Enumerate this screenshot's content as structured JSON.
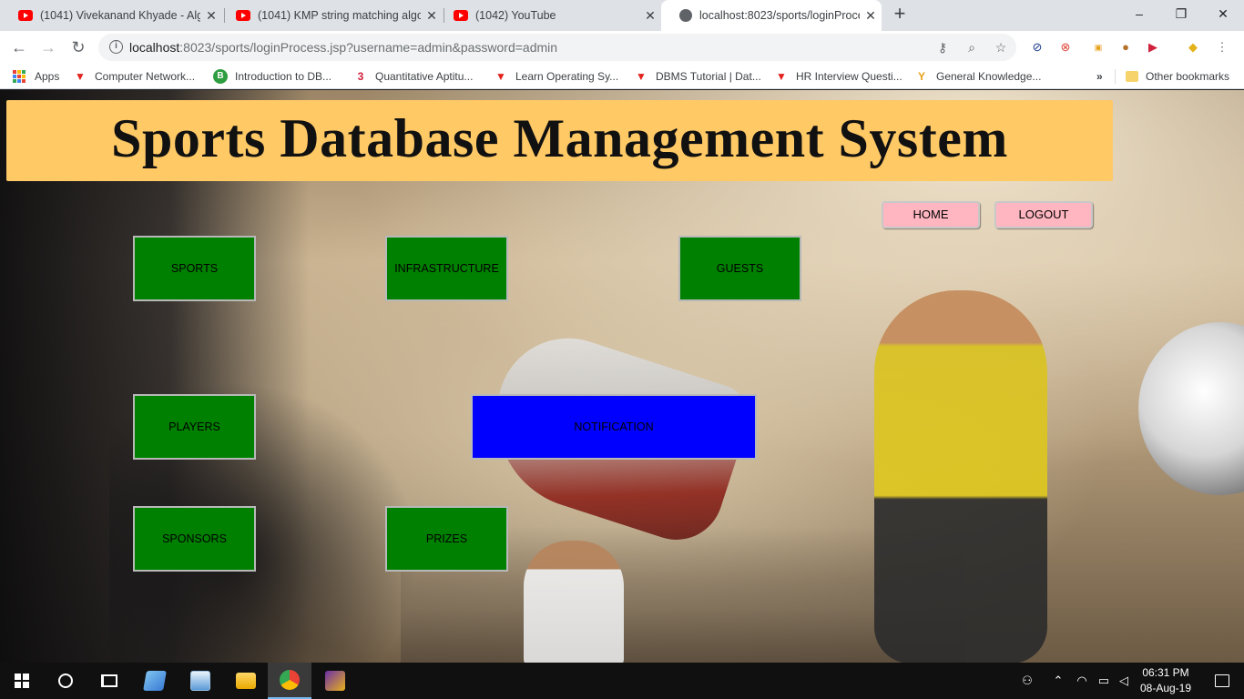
{
  "browser": {
    "tabs": [
      {
        "title": "(1041) Vivekanand Khyade - Algo",
        "favicon": "youtube-icon",
        "active": false
      },
      {
        "title": "(1041) KMP string matching algo",
        "favicon": "youtube-icon",
        "active": false
      },
      {
        "title": "(1042) YouTube",
        "favicon": "youtube-icon",
        "active": false
      },
      {
        "title": "localhost:8023/sports/loginProce",
        "favicon": "globe-icon",
        "active": true
      }
    ],
    "new_tab_label": "+",
    "window_controls": {
      "minimize": "–",
      "restore": "❐",
      "close": "✕"
    },
    "url": {
      "host": "localhost",
      "rest": ":8023/sports/loginProcess.jsp?username=admin&password=admin"
    },
    "bookmarks": [
      {
        "label": "Apps",
        "icon": "apps-grid-icon"
      },
      {
        "label": "Computer Network...",
        "icon": "bookmark-v-icon"
      },
      {
        "label": "Introduction to DB...",
        "icon": "bookmark-b-icon"
      },
      {
        "label": "Quantitative Aptitu...",
        "icon": "bookmark-3-icon"
      },
      {
        "label": "Learn Operating Sy...",
        "icon": "bookmark-v-icon"
      },
      {
        "label": "DBMS Tutorial | Dat...",
        "icon": "bookmark-v-icon"
      },
      {
        "label": "HR Interview Questi...",
        "icon": "bookmark-v-icon"
      },
      {
        "label": "General Knowledge...",
        "icon": "bookmark-person-icon"
      }
    ],
    "bookmarks_more": "»",
    "other_bookmarks": "Other bookmarks"
  },
  "page": {
    "title": "Sports Database Management System",
    "home_button": "HOME",
    "logout_button": "LOGOUT",
    "tiles": {
      "sports": "SPORTS",
      "infrastructure": "INFRASTRUCTURE",
      "guests": "GUESTS",
      "players": "PLAYERS",
      "notification": "NOTIFICATION",
      "sponsors": "SPONSORS",
      "prizes": "PRIZES"
    },
    "colors": {
      "banner": "#ffc966",
      "tile": "#008000",
      "notification": "#0000ff",
      "top_button": "#ffb6c1"
    }
  },
  "taskbar": {
    "time": "06:31 PM",
    "date": "08-Aug-19"
  }
}
